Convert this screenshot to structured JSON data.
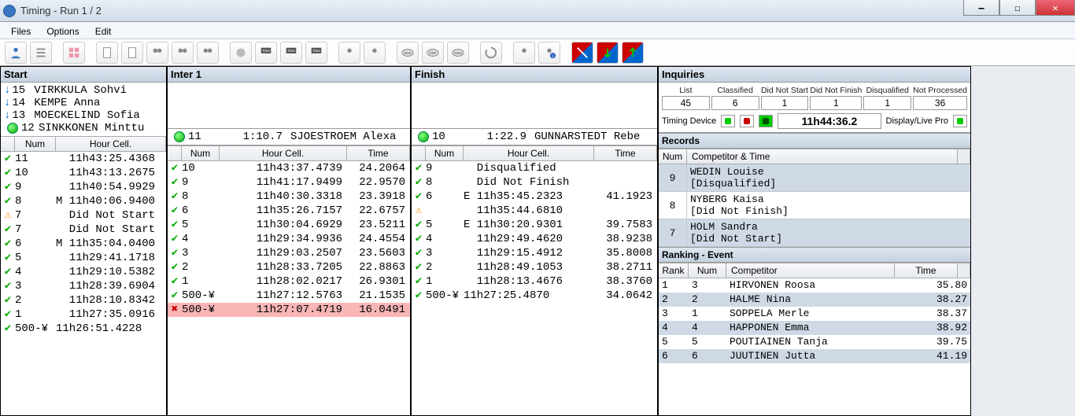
{
  "window": {
    "title": "Timing -   Run 1 / 2"
  },
  "menu": {
    "files": "Files",
    "options": "Options",
    "edit": "Edit"
  },
  "panels": {
    "start": {
      "title": "Start",
      "queue": [
        {
          "num": "15",
          "name": "VIRKKULA Sohvi"
        },
        {
          "num": "14",
          "name": "KEMPE Anna"
        },
        {
          "num": "13",
          "name": "MOECKELIND Sofia"
        },
        {
          "num": "12",
          "name": "SINKKONEN Minttu",
          "status": "go"
        }
      ],
      "cols": {
        "num": "Num",
        "hour": "Hour Cell."
      },
      "rows": [
        {
          "ic": "ok",
          "num": "11",
          "txt": "  11h43:25.4368"
        },
        {
          "ic": "ok",
          "num": "10",
          "txt": "  11h43:13.2675"
        },
        {
          "ic": "ok",
          "num": "9",
          "txt": "  11h40:54.9929"
        },
        {
          "ic": "ok",
          "num": "8",
          "txt": "M 11h40:06.9400"
        },
        {
          "ic": "warn",
          "num": "7",
          "txt": "  Did Not Start"
        },
        {
          "ic": "ok",
          "num": "7",
          "txt": "  Did Not Start"
        },
        {
          "ic": "ok",
          "num": "6",
          "txt": "M 11h35:04.0400"
        },
        {
          "ic": "ok",
          "num": "5",
          "txt": "  11h29:41.1718"
        },
        {
          "ic": "ok",
          "num": "4",
          "txt": "  11h29:10.5382"
        },
        {
          "ic": "ok",
          "num": "3",
          "txt": "  11h28:39.6904"
        },
        {
          "ic": "ok",
          "num": "2",
          "txt": "  11h28:10.8342"
        },
        {
          "ic": "ok",
          "num": "1",
          "txt": "  11h27:35.0916"
        },
        {
          "ic": "ok",
          "num": "500-¥",
          "txt": "11h26:51.4228"
        }
      ]
    },
    "inter": {
      "title": "Inter 1",
      "live": {
        "num": "11",
        "time": "1:10.7",
        "name": "SJOESTROEM Alexa"
      },
      "cols": {
        "num": "Num",
        "hour": "Hour Cell.",
        "time": "Time"
      },
      "rows": [
        {
          "ic": "ok",
          "num": "10",
          "hour": "11h43:37.4739",
          "time": "24.2064"
        },
        {
          "ic": "ok",
          "num": "9",
          "hour": "11h41:17.9499",
          "time": "22.9570"
        },
        {
          "ic": "ok",
          "num": "8",
          "hour": "11h40:30.3318",
          "time": "23.3918"
        },
        {
          "ic": "ok",
          "num": "6",
          "hour": "11h35:26.7157",
          "time": "22.6757"
        },
        {
          "ic": "ok",
          "num": "5",
          "hour": "11h30:04.6929",
          "time": "23.5211"
        },
        {
          "ic": "ok",
          "num": "4",
          "hour": "11h29:34.9936",
          "time": "24.4554"
        },
        {
          "ic": "ok",
          "num": "3",
          "hour": "11h29:03.2507",
          "time": "23.5603"
        },
        {
          "ic": "ok",
          "num": "2",
          "hour": "11h28:33.7205",
          "time": "22.8863"
        },
        {
          "ic": "ok",
          "num": "1",
          "hour": "11h28:02.0217",
          "time": "26.9301"
        },
        {
          "ic": "ok",
          "num": "500-¥",
          "hour": "11h27:12.5763",
          "time": "21.1535"
        },
        {
          "ic": "err",
          "num": "500-¥",
          "hour": "11h27:07.4719",
          "time": "16.0491",
          "bad": true
        }
      ]
    },
    "finish": {
      "title": "Finish",
      "live": {
        "num": "10",
        "time": "1:22.9",
        "name": "GUNNARSTEDT Rebe"
      },
      "cols": {
        "num": "Num",
        "hour": "Hour Cell.",
        "time": "Time"
      },
      "rows": [
        {
          "ic": "ok",
          "num": "9",
          "hour": "  Disqualified",
          "time": ""
        },
        {
          "ic": "ok",
          "num": "8",
          "hour": "  Did Not Finish",
          "time": ""
        },
        {
          "ic": "ok",
          "num": "6",
          "hour": "E 11h35:45.2323",
          "time": "41.1923"
        },
        {
          "ic": "warn",
          "num": "",
          "hour": "  11h35:44.6810",
          "time": ""
        },
        {
          "ic": "ok",
          "num": "5",
          "hour": "E 11h30:20.9301",
          "time": "39.7583"
        },
        {
          "ic": "ok",
          "num": "4",
          "hour": "  11h29:49.4620",
          "time": "38.9238"
        },
        {
          "ic": "ok",
          "num": "3",
          "hour": "  11h29:15.4912",
          "time": "35.8008"
        },
        {
          "ic": "ok",
          "num": "2",
          "hour": "  11h28:49.1053",
          "time": "38.2711"
        },
        {
          "ic": "ok",
          "num": "1",
          "hour": "  11h28:13.4676",
          "time": "38.3760"
        },
        {
          "ic": "ok",
          "num": "500-¥",
          "hour": "11h27:25.4870",
          "time": "34.0642"
        }
      ]
    }
  },
  "inquiries": {
    "title": "Inquiries",
    "stats": [
      {
        "lbl": "List",
        "val": "45"
      },
      {
        "lbl": "Classified",
        "val": "6"
      },
      {
        "lbl": "Did Not Start",
        "val": "1"
      },
      {
        "lbl": "Did Not Finish",
        "val": "1"
      },
      {
        "lbl": "Disqualified",
        "val": "1"
      },
      {
        "lbl": "Not Processed",
        "val": "36"
      }
    ],
    "timing_label": "Timing Device",
    "clock": "11h44:36.2",
    "display_label": "Display/Live Pro"
  },
  "records": {
    "title": "Records",
    "cols": {
      "num": "Num",
      "comp": "Competitor & Time"
    },
    "rows": [
      {
        "num": "9",
        "name": "WEDIN Louise",
        "status": "[Disqualified]"
      },
      {
        "num": "8",
        "name": "NYBERG Kaisa",
        "status": "[Did Not Finish]"
      },
      {
        "num": "7",
        "name": "HOLM Sandra",
        "status": "[Did Not Start]"
      }
    ]
  },
  "ranking": {
    "title": "Ranking - Event",
    "cols": {
      "rank": "Rank",
      "num": "Num",
      "comp": "Competitor",
      "time": "Time"
    },
    "rows": [
      {
        "rank": "1",
        "num": "3",
        "name": "HIRVONEN Roosa",
        "time": "35.80"
      },
      {
        "rank": "2",
        "num": "2",
        "name": "HALME Nina",
        "time": "38.27"
      },
      {
        "rank": "3",
        "num": "1",
        "name": "SOPPELA Merle",
        "time": "38.37"
      },
      {
        "rank": "4",
        "num": "4",
        "name": "HAPPONEN Emma",
        "time": "38.92"
      },
      {
        "rank": "5",
        "num": "5",
        "name": "POUTIAINEN Tanja",
        "time": "39.75"
      },
      {
        "rank": "6",
        "num": "6",
        "name": "JUUTINEN Jutta",
        "time": "41.19"
      }
    ]
  }
}
